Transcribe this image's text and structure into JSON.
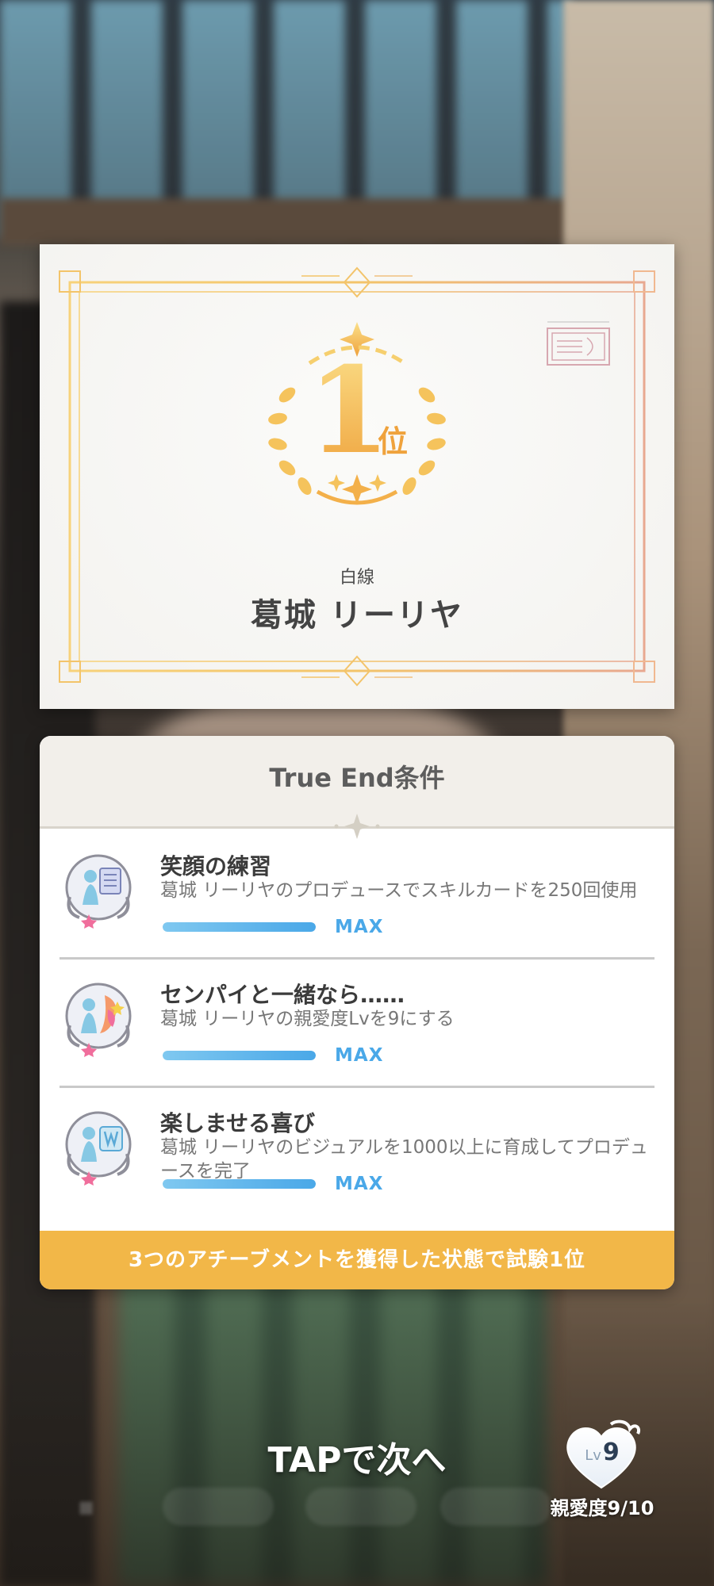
{
  "certificate": {
    "rank_number": "1",
    "rank_suffix": "位",
    "subtitle": "白線",
    "name": "葛城 リーリヤ",
    "accent_color": "#f0b04a"
  },
  "true_end": {
    "title": "True End条件",
    "achievements": [
      {
        "icon": "achievement-smile-practice-icon",
        "title": "笑顔の練習",
        "description": "葛城 リーリヤのプロデュースでスキルカードを250回使用",
        "progress": 1.0,
        "status": "MAX"
      },
      {
        "icon": "achievement-senpai-icon",
        "title": "センパイと一緒なら……",
        "description": "葛城 リーリヤの親愛度Lvを9にする",
        "progress": 1.0,
        "status": "MAX"
      },
      {
        "icon": "achievement-joy-icon",
        "title": "楽しませる喜び",
        "description": "葛城 リーリヤのビジュアルを1000以上に育成してプロデュースを完了",
        "progress": 1.0,
        "status": "MAX"
      }
    ],
    "footer": "3つのアチーブメントを獲得した状態で試験1位"
  },
  "hud": {
    "tap_next": "TAPで次へ",
    "affinity": {
      "lv_prefix": "Lv",
      "level": "9",
      "label": "親愛度9/10"
    }
  }
}
